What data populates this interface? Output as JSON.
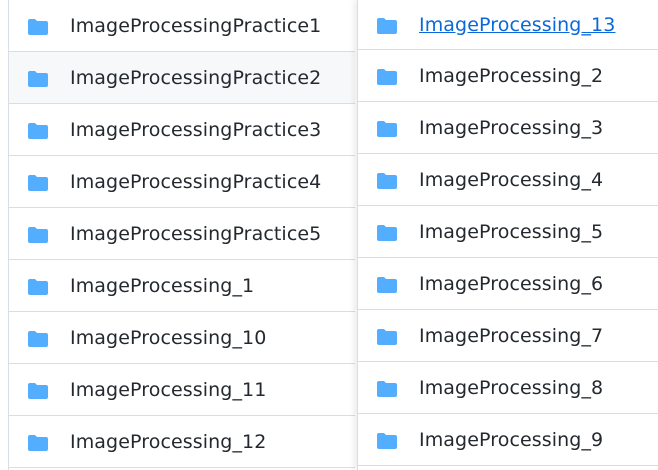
{
  "folder_color": "#54aeff",
  "left_list": [
    {
      "label": "ImageProcessingPractice1",
      "icon": "folder-icon"
    },
    {
      "label": "ImageProcessingPractice2",
      "icon": "folder-icon"
    },
    {
      "label": "ImageProcessingPractice3",
      "icon": "folder-icon"
    },
    {
      "label": "ImageProcessingPractice4",
      "icon": "folder-icon"
    },
    {
      "label": "ImageProcessingPractice5",
      "icon": "folder-icon"
    },
    {
      "label": "ImageProcessing_1",
      "icon": "folder-icon"
    },
    {
      "label": "ImageProcessing_10",
      "icon": "folder-icon"
    },
    {
      "label": "ImageProcessing_11",
      "icon": "folder-icon"
    },
    {
      "label": "ImageProcessing_12",
      "icon": "folder-icon"
    }
  ],
  "right_list": [
    {
      "label": "ImageProcessing_13",
      "icon": "folder-icon"
    },
    {
      "label": "ImageProcessing_2",
      "icon": "folder-icon"
    },
    {
      "label": "ImageProcessing_3",
      "icon": "folder-icon"
    },
    {
      "label": "ImageProcessing_4",
      "icon": "folder-icon"
    },
    {
      "label": "ImageProcessing_5",
      "icon": "folder-icon"
    },
    {
      "label": "ImageProcessing_6",
      "icon": "folder-icon"
    },
    {
      "label": "ImageProcessing_7",
      "icon": "folder-icon"
    },
    {
      "label": "ImageProcessing_8",
      "icon": "folder-icon"
    },
    {
      "label": "ImageProcessing_9",
      "icon": "folder-icon"
    }
  ]
}
